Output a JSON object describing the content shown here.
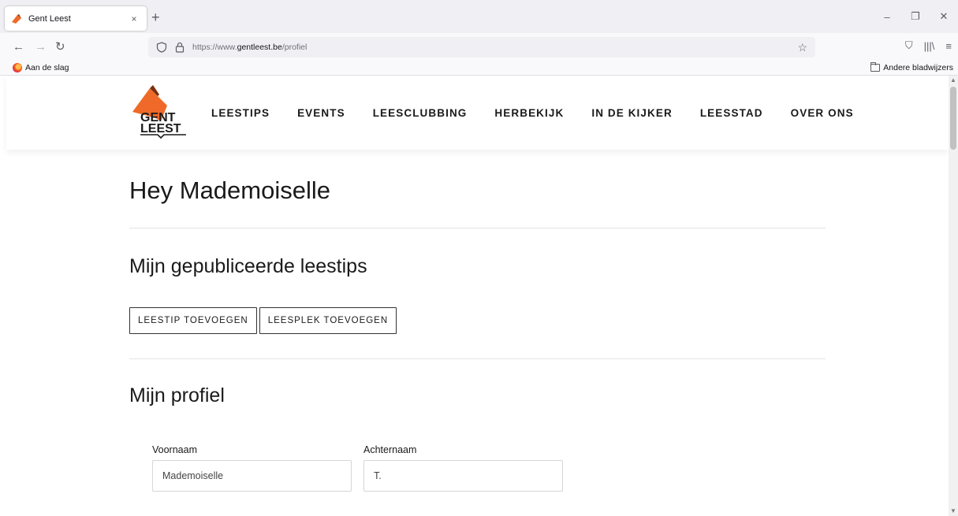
{
  "browser": {
    "tab_title": "Gent Leest",
    "tab_close": "×",
    "new_tab": "+",
    "url_scheme": "https://www.",
    "url_host": "gentleest.be",
    "url_path": "/profiel",
    "bookmark_left": "Aan de slag",
    "bookmark_right": "Andere bladwijzers",
    "icons": {
      "back": "←",
      "forward": "→",
      "reload": "↻",
      "star": "☆",
      "pocket": "⛉",
      "library": "|||\\",
      "menu": "≡",
      "minimize": "–",
      "restore": "❐",
      "close": "✕",
      "scroll_up": "▲",
      "scroll_down": "▼"
    }
  },
  "site": {
    "logo_line1": "GENT",
    "logo_line2": "LEEST",
    "brand_color": "#ef6a28",
    "nav": [
      "LEESTIPS",
      "EVENTS",
      "LEESCLUBBING",
      "HERBEKIJK",
      "IN DE KIJKER",
      "LEESSTAD",
      "OVER ONS"
    ]
  },
  "page": {
    "greeting": "Hey Mademoiselle",
    "tips_heading": "Mijn gepubliceerde leestips",
    "add_tip_button": "LEESTIP TOEVOEGEN",
    "add_place_button": "LEESPLEK TOEVOEGEN",
    "profile_heading": "Mijn profiel",
    "first_name_label": "Voornaam",
    "first_name_value": "Mademoiselle",
    "last_name_label": "Achternaam",
    "last_name_value": "T."
  }
}
